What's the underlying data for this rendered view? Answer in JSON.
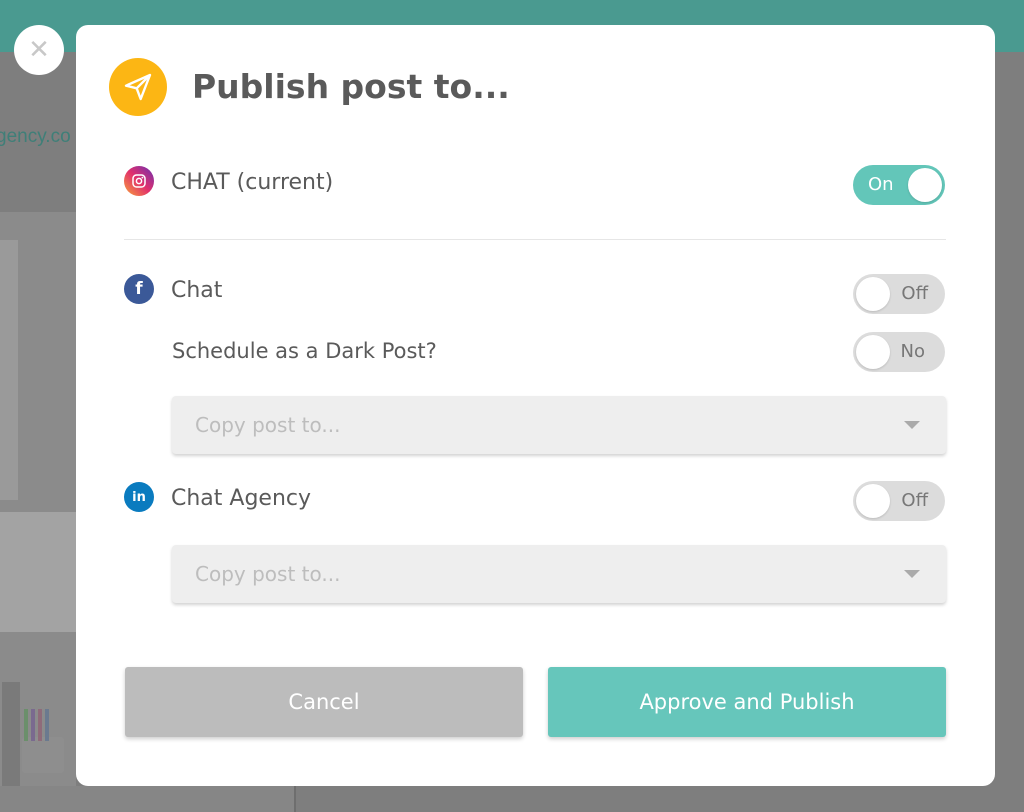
{
  "modal": {
    "title": "Publish post to...",
    "close_symbol": "✕",
    "header_icon": "paper-plane-icon",
    "accent_color": "#fcb614",
    "networks": [
      {
        "icon": "instagram-icon",
        "label": "CHAT (current)",
        "toggle": "On",
        "enabled": true
      },
      {
        "icon": "facebook-icon",
        "icon_glyph": "f",
        "label": "Chat",
        "toggle": "Off",
        "enabled": false,
        "dark_post": {
          "label": "Schedule as a Dark Post?",
          "toggle": "No"
        },
        "copy_placeholder": "Copy post to..."
      },
      {
        "icon": "linkedin-icon",
        "icon_glyph": "in",
        "label": "Chat Agency",
        "toggle": "Off",
        "enabled": false,
        "copy_placeholder": "Copy post to..."
      }
    ],
    "buttons": {
      "cancel": "Cancel",
      "publish": "Approve and Publish"
    },
    "colors": {
      "toggle_on": "#63c6b9",
      "publish": "#66c6bb",
      "cancel": "#bcbcbc",
      "facebook": "#3b5998",
      "linkedin": "#0a7bbf"
    }
  },
  "background": {
    "url_fragment": "gency.co"
  }
}
